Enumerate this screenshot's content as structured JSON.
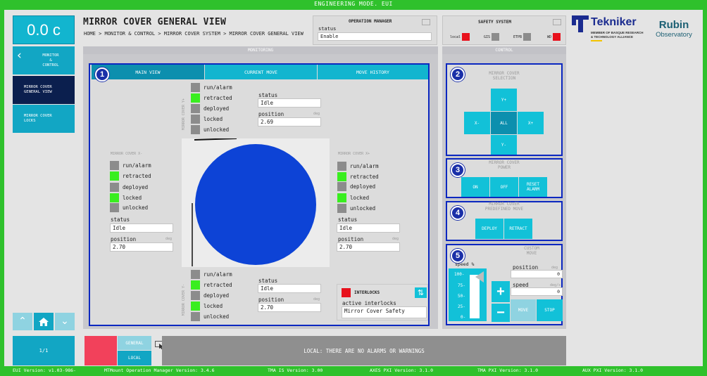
{
  "title_bar": "ENGINEERING MODE. EUI",
  "header": {
    "time": "0.0 c",
    "page_title": "MIRROR COVER GENERAL VIEW",
    "breadcrumb": "HOME > MONITOR & CONTROL > MIRROR COVER SYSTEM > MIRROR COVER GENERAL VIEW"
  },
  "sidebar": {
    "back_line1": "MONITOR",
    "back_line2": "&",
    "back_line3": "CONTROL",
    "item1_line1": "MIRROR COVER",
    "item1_line2": "GENERAL VIEW",
    "item2_line1": "MIRROR COVER",
    "item2_line2": "LOCKS",
    "page_counter": "1/1"
  },
  "op_manager": {
    "title": "OPERATION MANAGER",
    "status_label": "status",
    "status_value": "Enable"
  },
  "safety": {
    "title": "SAFETY SYSTEM",
    "local": "local",
    "gis": "GIS",
    "etpb": "ETPB",
    "wd": "WD"
  },
  "logos": {
    "tekniker": "Tekniker",
    "tekniker_sub1": "MEMBER OF BASQUE RESEARCH",
    "tekniker_sub2": "& TECHNOLOGY ALLIANCE",
    "rubin1": "Rubin",
    "rubin2": "Observatory"
  },
  "monitoring": {
    "title": "MONITORING",
    "tabs": [
      "MAIN VIEW",
      "CURRENT MOVE",
      "MOVE HISTORY"
    ]
  },
  "mirror": {
    "run_alarm": "run/alarm",
    "retracted": "retracted",
    "deployed": "deployed",
    "locked": "locked",
    "unlocked": "unlocked",
    "status_label": "status",
    "position_label": "position",
    "unit": "deg",
    "y_plus": {
      "name": "MIRROR COVER Y+",
      "status": "Idle",
      "position": "2.69"
    },
    "x_minus": {
      "name": "MIRROR COVER X-",
      "status": "Idle",
      "position": "2.70"
    },
    "x_plus": {
      "name": "MIRROR COVER X+",
      "status": "Idle",
      "position": "2.70"
    },
    "y_minus": {
      "name": "MIRROR COVER Y-",
      "status": "Idle",
      "position": "2.70"
    }
  },
  "interlocks": {
    "title": "INTERLOCKS",
    "active_label": "active interlocks",
    "value": "Mirror Cover Safety"
  },
  "control": {
    "title": "CONTROL",
    "selection_title1": "MIRROR COVER",
    "selection_title2": "SELECTION",
    "y_plus": "Y+",
    "x_minus": "X-",
    "all": "ALL",
    "x_plus": "X+",
    "y_minus": "Y-",
    "power_title1": "MIRROR COVER",
    "power_title2": "POWER",
    "on": "ON",
    "off": "OFF",
    "reset1": "RESET",
    "reset2": "ALARM",
    "predef_title1": "MIRROR COVER",
    "predef_title2": "PREDEFINED MOVE",
    "deploy": "DEPLOY",
    "retract": "RETRACT",
    "custom_title1": "CUSTOM",
    "custom_title2": "MOVE",
    "speed_pct": "speed %",
    "scale": [
      "100-",
      "75-",
      "50-",
      "25-",
      "0-"
    ],
    "position_label": "position",
    "position_unit": "deg",
    "position_value": "0",
    "speed_label": "speed",
    "speed_unit": "deg/s",
    "speed_value": "0",
    "plus": "+",
    "minus": "−",
    "move": "MOVE",
    "stop": "STOP",
    "speed_level": 1.0
  },
  "numbers": [
    "1",
    "2",
    "3",
    "4",
    "5"
  ],
  "footer": {
    "general": "GENERAL",
    "local": "LOCAL",
    "alarm_msg": "LOCAL: THERE ARE NO ALARMS OR WARNINGS"
  },
  "status_bar": [
    "EUI Version: v1.03-986-",
    "MTMount Operation Manager Version: 3.4.6",
    "TMA IS Version: 3.00",
    "AXES PXI Version: 3.1.0",
    "TMA PXI Version: 3.1.0",
    "AUX PXI Version: 3.1.0"
  ],
  "colors": {
    "accent": "#12a6c4",
    "selected": "#0b1f4e",
    "ok": "#39ee1f",
    "error": "#e8111c",
    "highlight": "#0b27c0",
    "disc": "#0d43d6"
  }
}
